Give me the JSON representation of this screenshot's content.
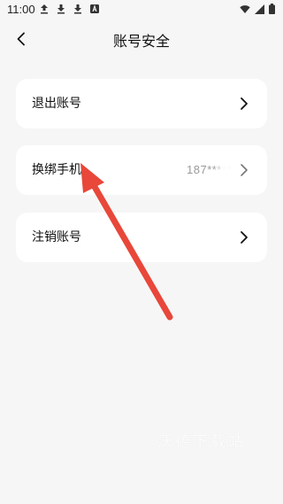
{
  "status_bar": {
    "time": "11:00",
    "icons": [
      "upload-icon",
      "download-icon",
      "download-icon",
      "app-a-icon"
    ],
    "right_icons": [
      "wifi-icon",
      "signal-icon",
      "battery-icon"
    ]
  },
  "header": {
    "back_icon": "back-arrow-icon",
    "title": "账号安全"
  },
  "items": [
    {
      "label": "退出账号",
      "value": "",
      "icon": "chevron-right-icon"
    },
    {
      "label": "换绑手机",
      "value": "187*****",
      "icon": "chevron-right-icon"
    },
    {
      "label": "注销账号",
      "value": "",
      "icon": "chevron-right-icon"
    }
  ],
  "annotation": {
    "color": "#e8473a"
  },
  "watermark": "沃德下载站"
}
